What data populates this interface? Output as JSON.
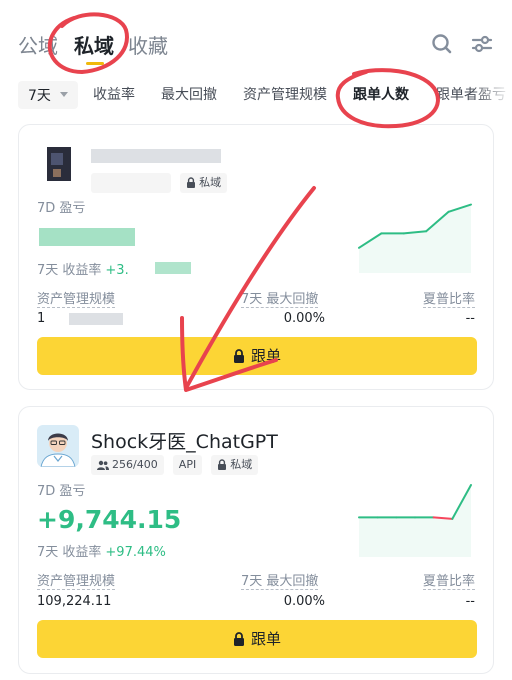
{
  "tabs": [
    {
      "label": "公域"
    },
    {
      "label": "私域"
    },
    {
      "label": "收藏"
    }
  ],
  "filters": {
    "period": "7天",
    "items": [
      "收益率",
      "最大回撤",
      "资产管理规模",
      "跟单人数",
      "跟单者盈亏"
    ]
  },
  "cards": [
    {
      "name": "",
      "badges": {
        "followers": "",
        "type": "私域"
      },
      "pnl_label": "7D 盈亏",
      "pnl_value": "",
      "roi_label": "7天 收益率",
      "roi_value": "+3.",
      "aum_label": "资产管理规模",
      "aum_value": "1",
      "mdd_label": "7天 最大回撤",
      "mdd_value": "0.00%",
      "sharpe_label": "夏普比率",
      "sharpe_value": "--",
      "button": "跟单",
      "sparkline": [
        0.35,
        0.55,
        0.55,
        0.58,
        0.85,
        0.95
      ]
    },
    {
      "name": "Shock牙医_ChatGPT",
      "badges": {
        "followers": "256/400",
        "api": "API",
        "type": "私域"
      },
      "pnl_label": "7D 盈亏",
      "pnl_value": "+9,744.15",
      "roi_label": "7天 收益率",
      "roi_value": "+97.44%",
      "aum_label": "资产管理规模",
      "aum_value": "109,224.11",
      "mdd_label": "7天 最大回撤",
      "mdd_value": "0.00%",
      "sharpe_label": "夏普比率",
      "sharpe_value": "--",
      "button": "跟单",
      "sparkline": [
        0.55,
        0.55,
        0.55,
        0.55,
        0.55,
        0.53,
        1.0
      ]
    }
  ],
  "colors": {
    "accent": "#fcd535",
    "profit": "#2ebd85",
    "loss": "#f6465d",
    "annotation": "#e8434e"
  }
}
